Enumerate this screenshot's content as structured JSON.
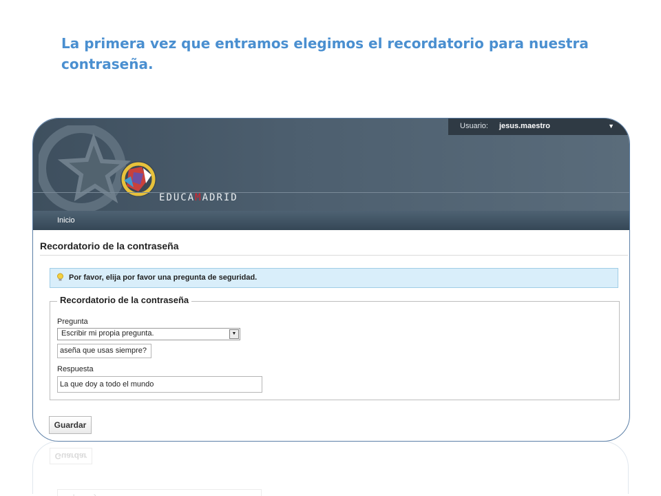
{
  "slide": {
    "title": "La primera vez que entramos elegimos el recordatorio para nuestra contraseña."
  },
  "header": {
    "brand_parts": [
      "E",
      "DUCA",
      "M",
      "ADRID"
    ],
    "user_label": "Usuario:",
    "user_name": "jesus.maestro",
    "caret_icon": "caret-down-icon"
  },
  "nav": {
    "items": [
      {
        "label": "Inicio"
      }
    ]
  },
  "page": {
    "title": "Recordatorio de la contraseña",
    "notice": "Por favor, elija por favor una pregunta de seguridad.",
    "notice_icon": "lightbulb-icon",
    "fieldset_legend": "Recordatorio de la contraseña",
    "question_label": "Pregunta",
    "question_select_value": "Escribir mi propia pregunta.",
    "custom_question_value": "aseña que usas siempre?",
    "answer_label": "Respuesta",
    "answer_value": "La que doy a todo el mundo",
    "save_label": "Guardar"
  },
  "colors": {
    "title_blue": "#4a8fd0",
    "header_dark": "#3e4f5e",
    "notice_bg": "#d9eefa",
    "brand_accent": "#d9232d"
  }
}
